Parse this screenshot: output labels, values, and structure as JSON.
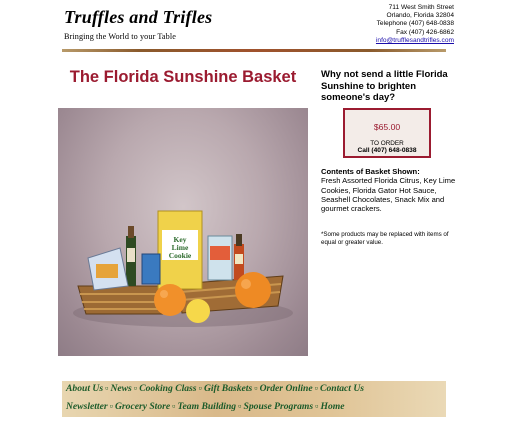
{
  "header": {
    "logo_title": "Truffles and Trifles",
    "logo_tagline": "Bringing the World to your Table",
    "address_street": "711 West Smith Street",
    "address_city": "Orlando, Florida 32804",
    "telephone": "Telephone (407) 648-0838",
    "fax": "Fax (407) 426-6862",
    "email": "info@trufflesandtrifles.com"
  },
  "main": {
    "title": "The Florida Sunshine Basket",
    "pitch": "Why not send a little Florida Sunshine to brighten someone's day?",
    "price": "$65.00",
    "order_label": "TO ORDER",
    "order_phone": "Call (407) 648-0838",
    "contents_title": "Contents of Basket Shown:",
    "contents_body": "Fresh Assorted Florida Citrus, Key Lime Cookies, Florida Gator Hot Sauce, Seashell Chocolates, Snack Mix and gourmet crackers.",
    "note": "*Some products may be replaced with items of equal or greater value.",
    "photo_label": "Key Lime Cookies"
  },
  "nav": {
    "row1": [
      "About Us",
      "News",
      "Cooking Class",
      "Gift Baskets",
      "Order Online",
      "Contact Us"
    ],
    "row2": [
      "Newsletter",
      "Grocery Store",
      "Team Building",
      "Spouse Programs",
      "Home"
    ]
  },
  "colors": {
    "title": "#9b1b30",
    "nav_text": "#1c5b2a",
    "link": "#1a0dab"
  }
}
